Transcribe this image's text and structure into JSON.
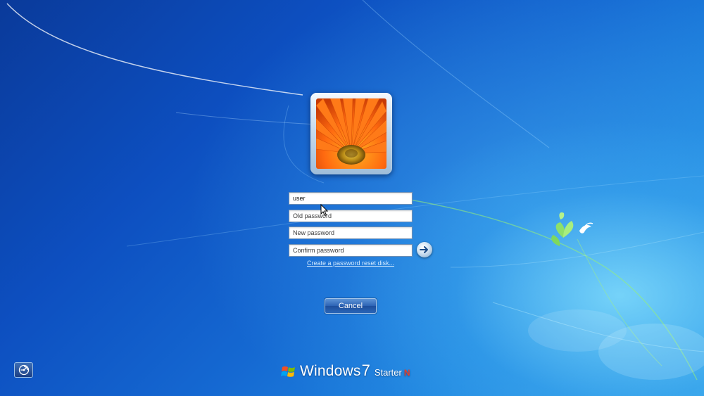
{
  "login": {
    "username": "user",
    "old_password_placeholder": "Old password",
    "new_password_placeholder": "New password",
    "confirm_password_placeholder": "Confirm password",
    "reset_link": "Create a password reset disk...",
    "cancel_label": "Cancel"
  },
  "branding": {
    "product": "Windows",
    "version": "7",
    "edition": "Starter",
    "edition_suffix": "N"
  },
  "icons": {
    "submit": "arrow-right-icon",
    "ease_of_access": "ease-of-access-icon",
    "logo": "windows-logo-icon"
  },
  "colors": {
    "background_dark": "#0a3a9a",
    "background_light": "#3aa6ea",
    "button_blue": "#2c63b4",
    "edition_red": "#e8402a"
  }
}
